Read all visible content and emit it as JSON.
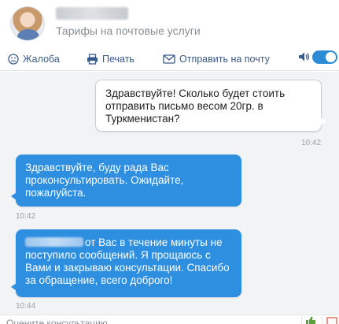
{
  "header": {
    "subtitle": "Тарифы на почтовые услуги"
  },
  "toolbar": {
    "complaint_label": "Жалоба",
    "print_label": "Печать",
    "email_label": "Отправить на почту",
    "sound_enabled": true
  },
  "messages": [
    {
      "from": "user",
      "text": "Здравствуйте! Сколько будет стоить отправить письмо весом 20гр. в Туркменистан?",
      "time": "10:42"
    },
    {
      "from": "agent",
      "text": "Здравствуйте, буду рада Вас проконсультировать. Ожидайте, пожалуйста.",
      "time": "10:42"
    },
    {
      "from": "agent",
      "text": "от Вас в течение минуты не поступило сообщений. Я прощаюсь с Вами и закрываю консультации. Спасибо за обращение, всего доброго!",
      "time": "10:44"
    }
  ],
  "footer": {
    "rate_label": "Оцените консультацию"
  },
  "colors": {
    "accent": "#2e8ee0",
    "link": "#3a5a8c",
    "chat_bg": "#f2f3f5",
    "rate_up": "#5aa03c",
    "rate_down": "#e05a4a"
  }
}
